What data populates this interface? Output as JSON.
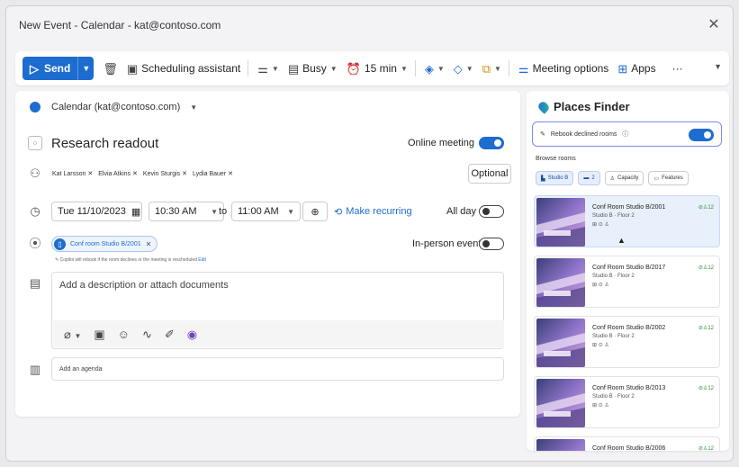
{
  "window": {
    "title": "New Event - Calendar - kat@contoso.com",
    "close_glyph": "✕"
  },
  "toolbar": {
    "send_label": "Send",
    "scheduling_label": "Scheduling assistant",
    "busy_label": "Busy",
    "reminder_label": "15 min",
    "meeting_options_label": "Meeting options",
    "apps_label": "Apps",
    "more_glyph": "···"
  },
  "form": {
    "calendar_label": "Calendar (kat@contoso.com)",
    "title": "Research readout",
    "online_meeting_label": "Online meeting",
    "online_meeting_on": true,
    "attendees": [
      "Kat Larsson",
      "Elvia Atkins",
      "Kevin Sturgis",
      "Lydia Bauer"
    ],
    "optional_label": "Optional",
    "date": "Tue 11/10/2023",
    "start_time": "10:30 AM",
    "to_label": "to",
    "end_time": "11:00 AM",
    "make_recurring_label": "Make recurring",
    "all_day_label": "All day",
    "all_day_on": false,
    "room_chip": "Conf room Studio B/2001",
    "in_person_label": "In-person event",
    "in_person_on": false,
    "copilot_hint": "Copilot will rebook if the room declines or the meeting is rescheduled",
    "copilot_edit": "Edit",
    "description_placeholder": "Add a description or attach documents",
    "agenda_placeholder": "Add an agenda"
  },
  "places": {
    "title": "Places Finder",
    "rebook_label": "Rebook declined rooms",
    "rebook_on": true,
    "browse_label": "Browse rooms",
    "filters": [
      {
        "label": "Studio B",
        "icon": "building-icon",
        "selected": true
      },
      {
        "label": "2",
        "icon": "floor-icon",
        "selected": true
      },
      {
        "label": "Capacity",
        "icon": "people-icon",
        "selected": false
      },
      {
        "label": "Features",
        "icon": "features-icon",
        "selected": false
      }
    ],
    "rooms": [
      {
        "name": "Conf Room Studio B/2001",
        "location": "Studio B · Floor 2",
        "capacity": "12",
        "selected": true
      },
      {
        "name": "Conf Room Studio B/2017",
        "location": "Studio B · Floor 2",
        "capacity": "12",
        "selected": false
      },
      {
        "name": "Conf Room Studio B/2002",
        "location": "Studio B · Floor 2",
        "capacity": "12",
        "selected": false
      },
      {
        "name": "Conf Room Studio B/2013",
        "location": "Studio B · Floor 2",
        "capacity": "12",
        "selected": false
      },
      {
        "name": "Conf Room Studio B/2006",
        "location": "",
        "capacity": "12",
        "selected": false
      }
    ]
  },
  "colors": {
    "accent": "#1d6ccf",
    "available": "#2e8b3f"
  }
}
